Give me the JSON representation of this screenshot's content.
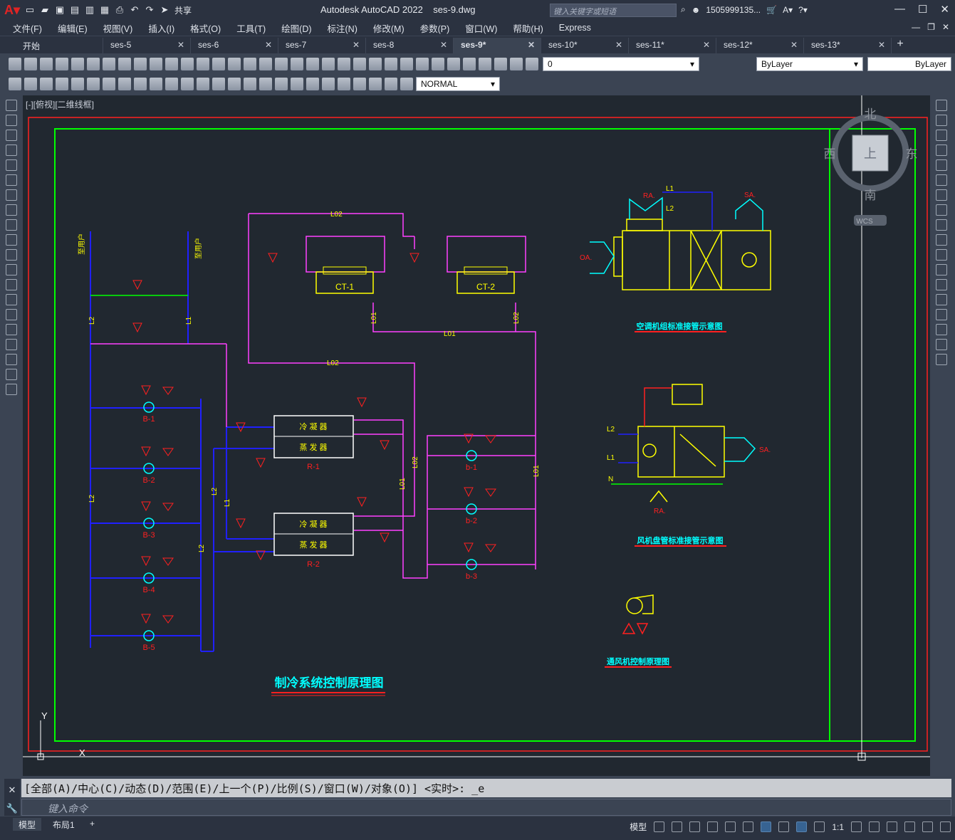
{
  "title_bar": {
    "app_title": "Autodesk AutoCAD 2022    ses-9.dwg",
    "share_label": "共享",
    "search_placeholder": "键入关键字或短语",
    "user": "1505999135...",
    "icons": [
      "app-logo-icon",
      "new-icon",
      "open-icon",
      "save-icon",
      "saveas-icon",
      "open-web-icon",
      "save-web-icon",
      "plot-icon",
      "undo-icon",
      "redo-icon",
      "share-icon",
      "search-icon",
      "user-icon",
      "cart-icon",
      "autodesk-icon",
      "help-icon"
    ]
  },
  "menu": [
    "文件(F)",
    "编辑(E)",
    "视图(V)",
    "插入(I)",
    "格式(O)",
    "工具(T)",
    "绘图(D)",
    "标注(N)",
    "修改(M)",
    "参数(P)",
    "窗口(W)",
    "帮助(H)",
    "Express"
  ],
  "tabs": [
    {
      "label": "开始",
      "active": false
    },
    {
      "label": "ses-5",
      "active": false
    },
    {
      "label": "ses-6",
      "active": false
    },
    {
      "label": "ses-7",
      "active": false
    },
    {
      "label": "ses-8",
      "active": false
    },
    {
      "label": "ses-9*",
      "active": true
    },
    {
      "label": "ses-10*",
      "active": false
    },
    {
      "label": "ses-11*",
      "active": false
    },
    {
      "label": "ses-12*",
      "active": false
    },
    {
      "label": "ses-13*",
      "active": false
    }
  ],
  "layer_combo": "0",
  "color_combo": "ByLayer",
  "linetype_combo": "ByLayer",
  "dimstyle_combo": "NORMAL",
  "view_label": "[-][俯视][二维线框]",
  "viewcube": {
    "n": "北",
    "s": "南",
    "e": "东",
    "w": "西",
    "top": "上",
    "wcs": "WCS"
  },
  "drawing": {
    "main_title": "制冷系统控制原理图",
    "ahu_title": "空调机组标准接管示意图",
    "fcu_title": "风机盘管标准接管示意图",
    "fan_title": "通风机控制原理图",
    "lines": {
      "l1": "L1",
      "l2": "L2",
      "l01": "L01",
      "l02": "L02",
      "n": "N"
    },
    "cooling_towers": [
      "CT-1",
      "CT-2"
    ],
    "chillers": [
      "R-1",
      "R-2"
    ],
    "chiller_top": "冷 凝 器",
    "chiller_bottom": "蒸 发 器",
    "pumps_B": [
      "B-1",
      "B-2",
      "B-3",
      "B-4",
      "B-5"
    ],
    "pumps_b": [
      "b-1",
      "b-2",
      "b-3"
    ],
    "ahu_labels": {
      "ra": "RA.",
      "sa": "SA.",
      "oa": "OA."
    },
    "fcu_labels": {
      "sa": "SA.",
      "ra": "RA."
    },
    "supply_label": "至用户",
    "return_label": "至用户",
    "colors": {
      "red": "#ff2020",
      "yellow": "#ffff00",
      "magenta": "#ff40ff",
      "blue": "#2020ff",
      "cyan": "#00ffff",
      "green": "#00ff00",
      "white": "#ffffff"
    }
  },
  "ucs": {
    "x": "X",
    "y": "Y"
  },
  "command_history": "[全部(A)/中心(C)/动态(D)/范围(E)/上一个(P)/比例(S)/窗口(W)/对象(O)] <实时>: _e",
  "command_placeholder": "键入命令",
  "layout_tabs": [
    "模型",
    "布局1"
  ],
  "status_model": "模型",
  "status_scale": "1:1"
}
